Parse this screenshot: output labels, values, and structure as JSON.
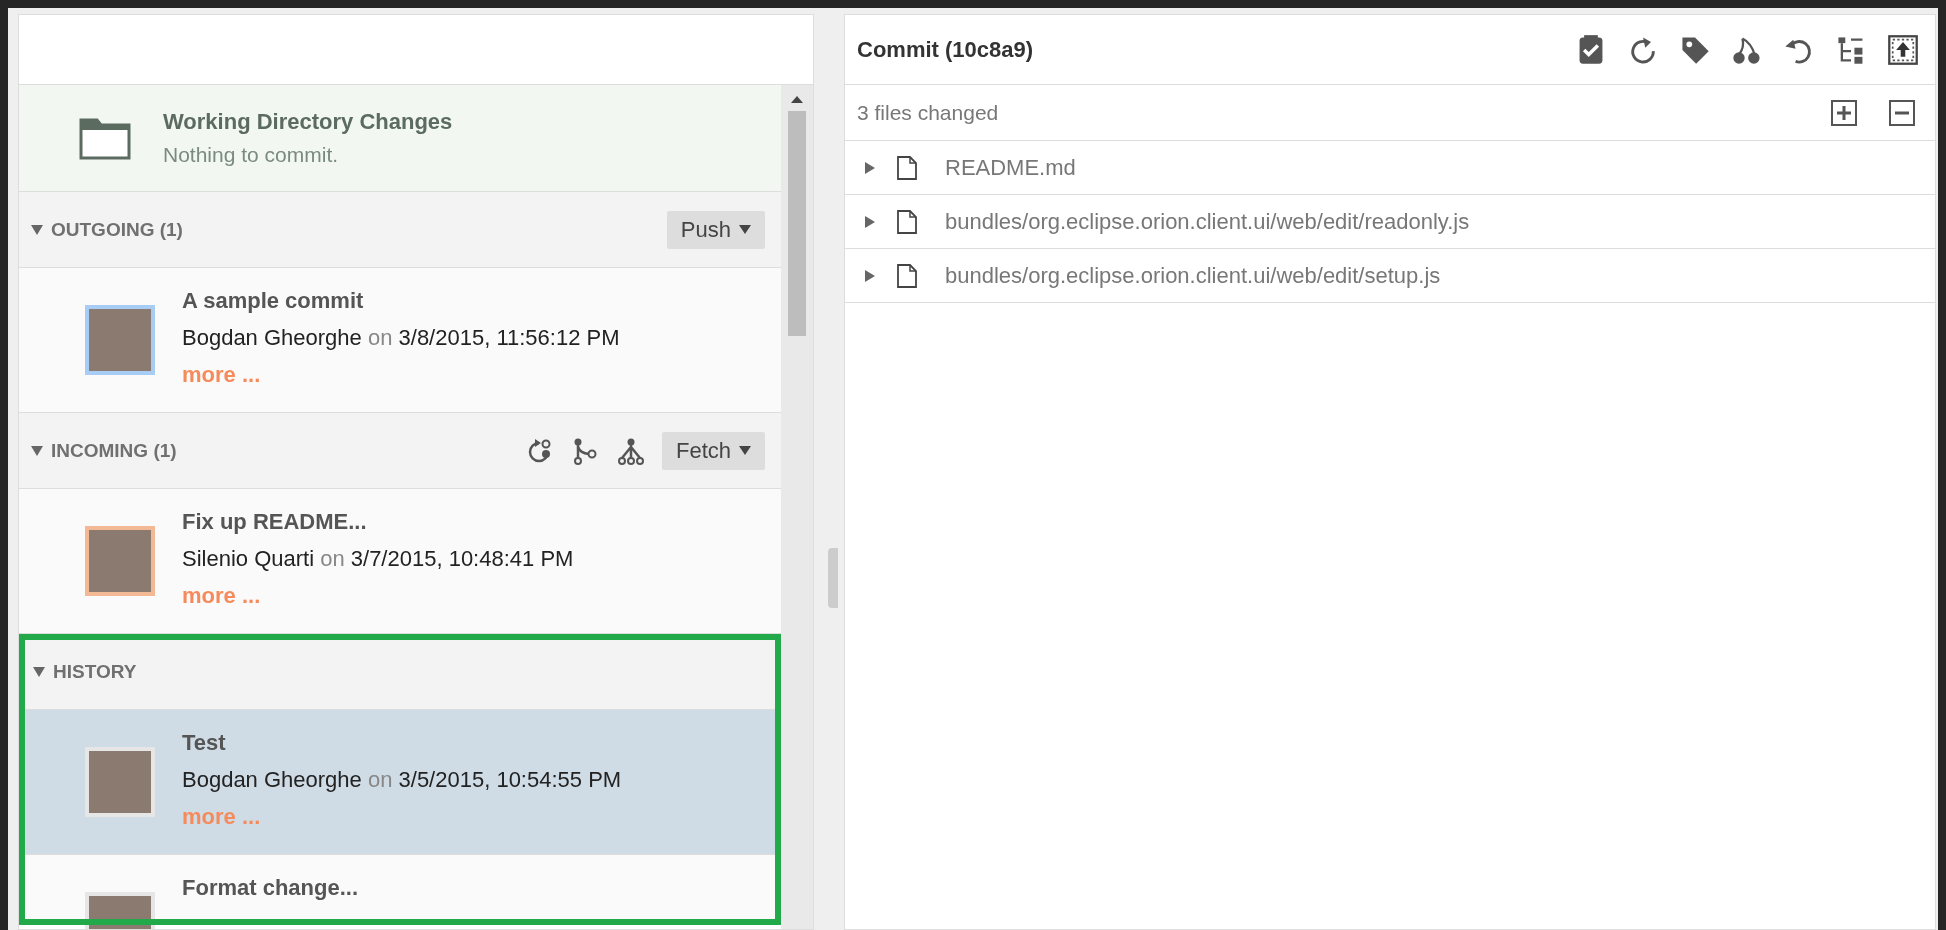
{
  "working_directory": {
    "title": "Working Directory Changes",
    "status": "Nothing to commit."
  },
  "sections": [
    {
      "kind": "outgoing",
      "title": "OUTGOING (1)",
      "expanded": true,
      "action": "Push",
      "commits": [
        {
          "title": "A sample commit",
          "author": "Bogdan Gheorghe",
          "joiner": "on",
          "date": "3/8/2015, 11:56:12 PM",
          "more": "more ...",
          "selected": false
        }
      ]
    },
    {
      "kind": "incoming",
      "title": "INCOMING (1)",
      "expanded": true,
      "action": "Fetch",
      "commits": [
        {
          "title": "Fix up README...",
          "author": "Silenio Quarti",
          "joiner": "on",
          "date": "3/7/2015, 10:48:41 PM",
          "more": "more ...",
          "selected": false
        }
      ]
    },
    {
      "kind": "history",
      "title": "HISTORY",
      "expanded": true,
      "highlighted": true,
      "commits": [
        {
          "title": "Test",
          "author": "Bogdan Gheorghe",
          "joiner": "on",
          "date": "3/5/2015, 10:54:55 PM",
          "more": "more ...",
          "selected": true
        },
        {
          "title": "Format change...",
          "selected": false
        }
      ]
    }
  ],
  "commit_panel": {
    "title": "Commit (10c8a9)",
    "summary": "3 files changed",
    "files": [
      {
        "name": "README.md",
        "expanded": false
      },
      {
        "name": "bundles/org.eclipse.orion.client.ui/web/edit/readonly.js",
        "expanded": false
      },
      {
        "name": "bundles/org.eclipse.orion.client.ui/web/edit/setup.js",
        "expanded": false
      }
    ]
  }
}
